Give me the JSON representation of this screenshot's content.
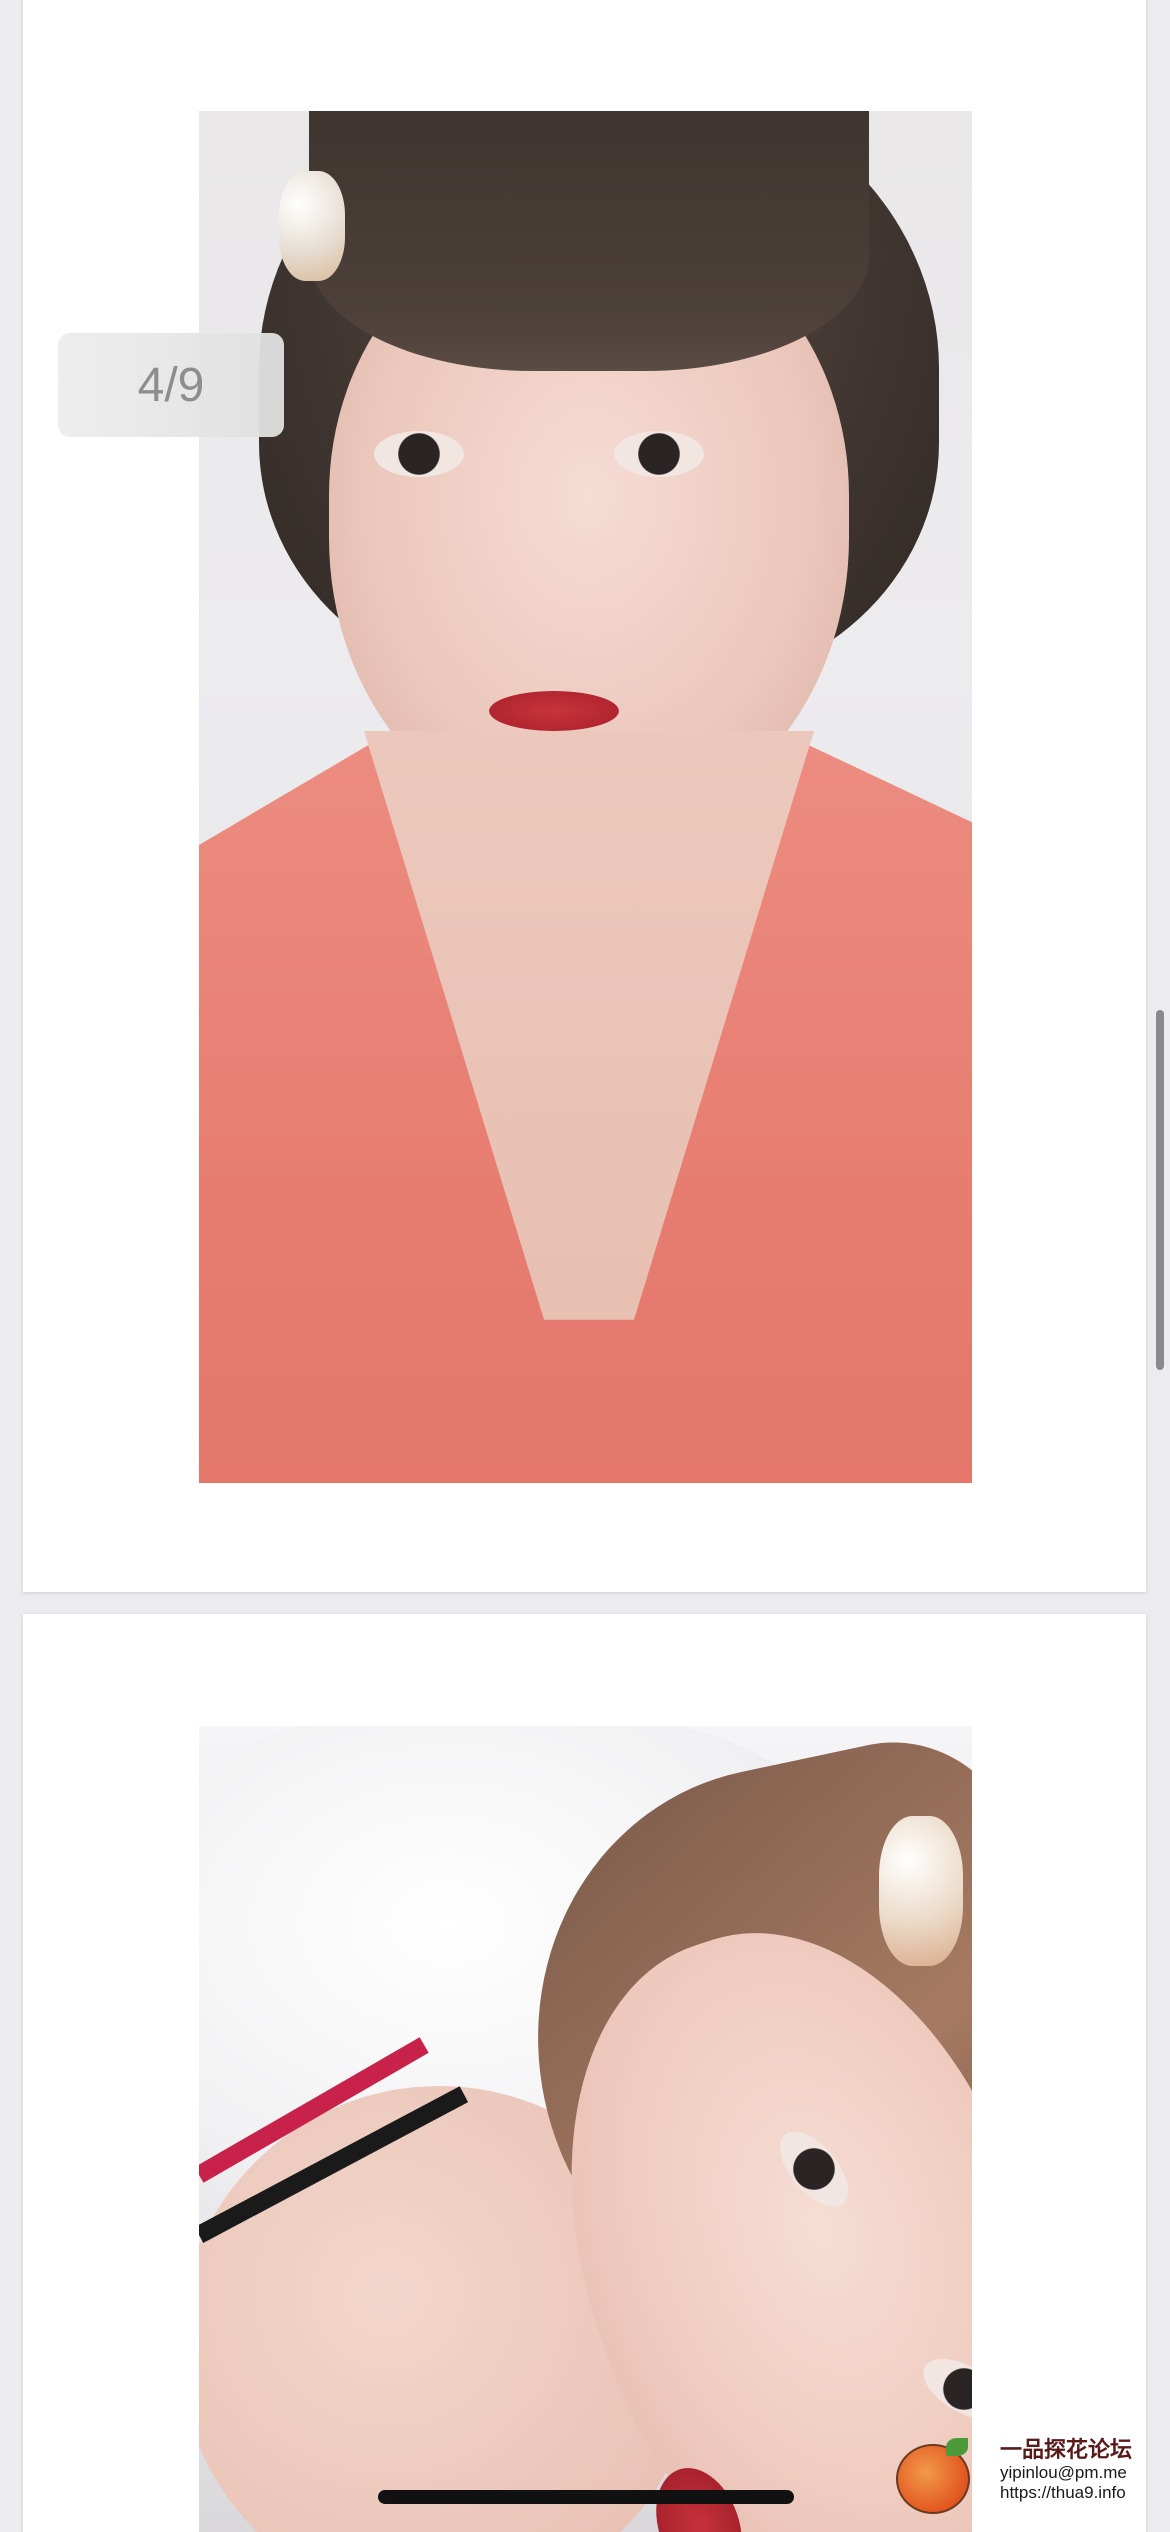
{
  "viewer": {
    "counter": "4/9"
  },
  "watermark": {
    "title": "一品探花论坛",
    "email": "yipinlou@pm.me",
    "url": "https://thua9.info"
  },
  "colors": {
    "background": "#ebebf0",
    "card": "#ffffff",
    "counter_text": "#8d8d8d",
    "home_indicator": "#111111"
  }
}
